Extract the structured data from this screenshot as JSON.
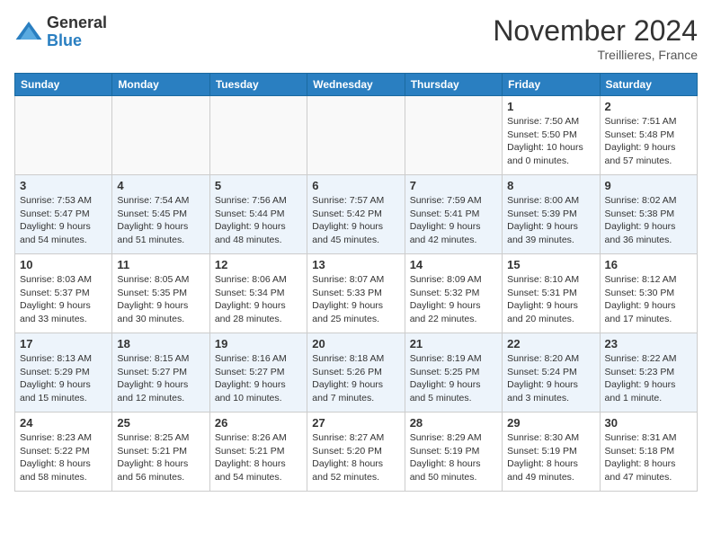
{
  "logo": {
    "general": "General",
    "blue": "Blue"
  },
  "title": "November 2024",
  "location": "Treillieres, France",
  "weekdays": [
    "Sunday",
    "Monday",
    "Tuesday",
    "Wednesday",
    "Thursday",
    "Friday",
    "Saturday"
  ],
  "weeks": [
    [
      {
        "day": "",
        "info": ""
      },
      {
        "day": "",
        "info": ""
      },
      {
        "day": "",
        "info": ""
      },
      {
        "day": "",
        "info": ""
      },
      {
        "day": "",
        "info": ""
      },
      {
        "day": "1",
        "info": "Sunrise: 7:50 AM\nSunset: 5:50 PM\nDaylight: 10 hours\nand 0 minutes."
      },
      {
        "day": "2",
        "info": "Sunrise: 7:51 AM\nSunset: 5:48 PM\nDaylight: 9 hours\nand 57 minutes."
      }
    ],
    [
      {
        "day": "3",
        "info": "Sunrise: 7:53 AM\nSunset: 5:47 PM\nDaylight: 9 hours\nand 54 minutes."
      },
      {
        "day": "4",
        "info": "Sunrise: 7:54 AM\nSunset: 5:45 PM\nDaylight: 9 hours\nand 51 minutes."
      },
      {
        "day": "5",
        "info": "Sunrise: 7:56 AM\nSunset: 5:44 PM\nDaylight: 9 hours\nand 48 minutes."
      },
      {
        "day": "6",
        "info": "Sunrise: 7:57 AM\nSunset: 5:42 PM\nDaylight: 9 hours\nand 45 minutes."
      },
      {
        "day": "7",
        "info": "Sunrise: 7:59 AM\nSunset: 5:41 PM\nDaylight: 9 hours\nand 42 minutes."
      },
      {
        "day": "8",
        "info": "Sunrise: 8:00 AM\nSunset: 5:39 PM\nDaylight: 9 hours\nand 39 minutes."
      },
      {
        "day": "9",
        "info": "Sunrise: 8:02 AM\nSunset: 5:38 PM\nDaylight: 9 hours\nand 36 minutes."
      }
    ],
    [
      {
        "day": "10",
        "info": "Sunrise: 8:03 AM\nSunset: 5:37 PM\nDaylight: 9 hours\nand 33 minutes."
      },
      {
        "day": "11",
        "info": "Sunrise: 8:05 AM\nSunset: 5:35 PM\nDaylight: 9 hours\nand 30 minutes."
      },
      {
        "day": "12",
        "info": "Sunrise: 8:06 AM\nSunset: 5:34 PM\nDaylight: 9 hours\nand 28 minutes."
      },
      {
        "day": "13",
        "info": "Sunrise: 8:07 AM\nSunset: 5:33 PM\nDaylight: 9 hours\nand 25 minutes."
      },
      {
        "day": "14",
        "info": "Sunrise: 8:09 AM\nSunset: 5:32 PM\nDaylight: 9 hours\nand 22 minutes."
      },
      {
        "day": "15",
        "info": "Sunrise: 8:10 AM\nSunset: 5:31 PM\nDaylight: 9 hours\nand 20 minutes."
      },
      {
        "day": "16",
        "info": "Sunrise: 8:12 AM\nSunset: 5:30 PM\nDaylight: 9 hours\nand 17 minutes."
      }
    ],
    [
      {
        "day": "17",
        "info": "Sunrise: 8:13 AM\nSunset: 5:29 PM\nDaylight: 9 hours\nand 15 minutes."
      },
      {
        "day": "18",
        "info": "Sunrise: 8:15 AM\nSunset: 5:27 PM\nDaylight: 9 hours\nand 12 minutes."
      },
      {
        "day": "19",
        "info": "Sunrise: 8:16 AM\nSunset: 5:27 PM\nDaylight: 9 hours\nand 10 minutes."
      },
      {
        "day": "20",
        "info": "Sunrise: 8:18 AM\nSunset: 5:26 PM\nDaylight: 9 hours\nand 7 minutes."
      },
      {
        "day": "21",
        "info": "Sunrise: 8:19 AM\nSunset: 5:25 PM\nDaylight: 9 hours\nand 5 minutes."
      },
      {
        "day": "22",
        "info": "Sunrise: 8:20 AM\nSunset: 5:24 PM\nDaylight: 9 hours\nand 3 minutes."
      },
      {
        "day": "23",
        "info": "Sunrise: 8:22 AM\nSunset: 5:23 PM\nDaylight: 9 hours\nand 1 minute."
      }
    ],
    [
      {
        "day": "24",
        "info": "Sunrise: 8:23 AM\nSunset: 5:22 PM\nDaylight: 8 hours\nand 58 minutes."
      },
      {
        "day": "25",
        "info": "Sunrise: 8:25 AM\nSunset: 5:21 PM\nDaylight: 8 hours\nand 56 minutes."
      },
      {
        "day": "26",
        "info": "Sunrise: 8:26 AM\nSunset: 5:21 PM\nDaylight: 8 hours\nand 54 minutes."
      },
      {
        "day": "27",
        "info": "Sunrise: 8:27 AM\nSunset: 5:20 PM\nDaylight: 8 hours\nand 52 minutes."
      },
      {
        "day": "28",
        "info": "Sunrise: 8:29 AM\nSunset: 5:19 PM\nDaylight: 8 hours\nand 50 minutes."
      },
      {
        "day": "29",
        "info": "Sunrise: 8:30 AM\nSunset: 5:19 PM\nDaylight: 8 hours\nand 49 minutes."
      },
      {
        "day": "30",
        "info": "Sunrise: 8:31 AM\nSunset: 5:18 PM\nDaylight: 8 hours\nand 47 minutes."
      }
    ]
  ]
}
